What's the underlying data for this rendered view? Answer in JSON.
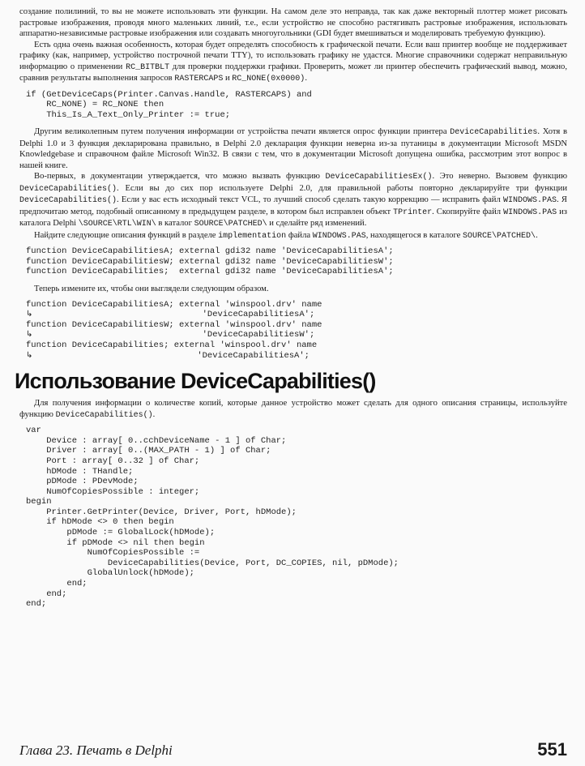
{
  "paragraphs": {
    "p1": "создание полилиний, то вы не можете использовать эти функции. На самом деле это неправда, так как даже векторный плоттер может рисовать растровые изображения, проводя много маленьких линий, т.е., если устройство не способно растягивать растровые изображения, использовать аппаратно-независимые растровые изображения или создавать многоугольники (GDI будет вмешиваться и моделировать требуемую функцию).",
    "p2a": "Есть одна очень важная особенность, которая будет определять способность к графической печати. Если ваш принтер вообще не поддерживает графику (как, например, устройство построчной печати TTY), то использовать графику не удастся. Многие справочники содержат неправильную информацию о применении ",
    "p2b": "RC_BITBLT",
    "p2c": " для проверки поддержки графики. Проверить, может ли принтер обеспечить графический вывод, можно, сравнив результаты выполнения запросов ",
    "p2d": "RASTERCAPS",
    "p2e": " и ",
    "p2f": "RC_NONE(0x0000)",
    "p2g": ".",
    "p3a": "Другим великолепным путем получения информации от устройства печати является опрос функции принтера ",
    "p3b": "DeviceCapabilities",
    "p3c": ". Хотя в Delphi 1.0 и 3 функция декларирована правильно, в Delphi 2.0 декларация функции неверна из-за путаницы в документации Microsoft MSDN Knowledgebase и справочном файле Microsoft Win32. В связи с тем, что в документации Microsoft допущена ошибка, рассмотрим этот вопрос в нашей книге.",
    "p4a": "Во-первых, в документации утверждается, что можно вызвать функцию ",
    "p4b": "DeviceCapabilitiesEx()",
    "p4c": ". Это неверно. Вызовем функцию ",
    "p4d": "DeviceCapabilities()",
    "p4e": ". Если вы до сих пор используете Delphi 2.0, для правильной работы повторно декларируйте три функции ",
    "p4f": "DeviceCapabilities()",
    "p4g": ". Если у вас есть исходный текст VCL, то лучший способ сделать такую коррекцию — исправить файл ",
    "p4h": "WINDOWS.PAS",
    "p4i": ". Я предпочитаю метод, подобный описанному в предыдущем разделе, в котором был исправлен объект ",
    "p4j": "TPrinter",
    "p4k": ". Скопируйте файл ",
    "p4l": "WINDOWS.PAS",
    "p4m": " из каталога Delphi ",
    "p4n": "\\SOURCE\\RTL\\WIN\\",
    "p4o": " в каталог ",
    "p4p": "SOURCE\\PATCHED\\",
    "p4q": " и сделайте ряд изменений.",
    "p5a": "Найдите следующие описания функций в разделе ",
    "p5b": "implementation",
    "p5c": " файла ",
    "p5d": "WINDOWS.PAS",
    "p5e": ", находящегося в каталоге ",
    "p5f": "SOURCE\\PATCHED\\",
    "p5g": ".",
    "p6": "Теперь измените их, чтобы они выглядели следующим образом.",
    "p7a": "Для получения информации о количестве копий, которые данное устройство может сделать для одного описания страницы, используйте функцию ",
    "p7b": "DeviceCapabilities()",
    "p7c": "."
  },
  "code": {
    "block1": [
      "if (GetDeviceCaps(Printer.Canvas.Handle, RASTERCAPS) and",
      "    RC_NONE) = RC_NONE then",
      "    This_Is_A_Text_Only_Printer := true;"
    ],
    "block2": [
      "function DeviceCapabilitiesA; external gdi32 name 'DeviceCapabilitiesA';",
      "function DeviceCapabilitiesW; external gdi32 name 'DeviceCapabilitiesW';",
      "function DeviceCapabilities;  external gdi32 name 'DeviceCapabilitiesA';"
    ],
    "block3": [
      "function DeviceCapabilitiesA; external 'winspool.drv' name",
      "                                'DeviceCapabilitiesA';",
      "function DeviceCapabilitiesW; external 'winspool.drv' name",
      "                                'DeviceCapabilitiesW';",
      "function DeviceCapabilities; external 'winspool.drv' name",
      "                               'DeviceCapabilitiesA';"
    ],
    "block4": [
      "var",
      "    Device : array[ 0..cchDeviceName - 1 ] of Char;",
      "    Driver : array[ 0..(MAX_PATH - 1) ] of Char;",
      "    Port : array[ 0..32 ] of Char;",
      "    hDMode : THandle;",
      "    pDMode : PDevMode;",
      "    NumOfCopiesPossible : integer;",
      "begin",
      "    Printer.GetPrinter(Device, Driver, Port, hDMode);",
      "    if hDMode <> 0 then begin",
      "        pDMode := GlobalLock(hDMode);",
      "        if pDMode <> nil then begin",
      "            NumOfCopiesPossible :=",
      "                DeviceCapabilities(Device, Port, DC_COPIES, nil, pDMode);",
      "            GlobalUnlock(hDMode);",
      "        end;",
      "    end;",
      "end;"
    ]
  },
  "continuation_glyph": "↳",
  "heading": "Использование DeviceCapabilities()",
  "footer": {
    "chapter": "Глава 23. Печать в Delphi",
    "page_number": "551"
  }
}
